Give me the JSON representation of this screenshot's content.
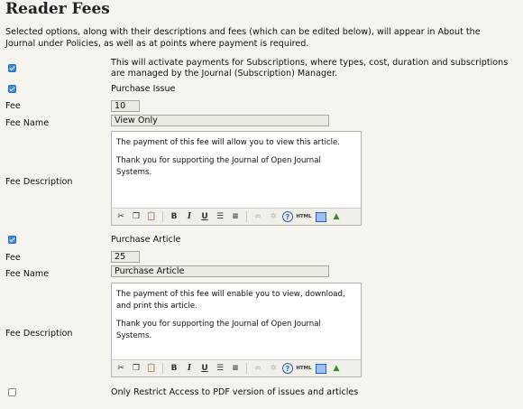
{
  "page": {
    "title": "Reader Fees",
    "intro": "Selected options, along with their descriptions and fees (which can be edited below), will appear in About the Journal under Policies, as well as at points where payment is required."
  },
  "subscriptions": {
    "checked": true,
    "text": "This will activate payments for Subscriptions, where types, cost, duration and subscriptions are managed by the Journal (Subscription) Manager."
  },
  "purchase_issue": {
    "checked": true,
    "label": "Purchase Issue",
    "fee_label": "Fee",
    "fee_value": "10",
    "fee_name_label": "Fee Name",
    "fee_name_value": "View Only",
    "desc_label": "Fee Description",
    "desc_paragraphs": [
      "The payment of this fee will allow you to view this article.",
      "Thank you for supporting the Journal of Open Journal Systems."
    ]
  },
  "purchase_article": {
    "checked": true,
    "label": "Purchase Article",
    "fee_label": "Fee",
    "fee_value": "25",
    "fee_name_label": "Fee Name",
    "fee_name_value": "Purchase Article",
    "desc_label": "Fee Description",
    "desc_paragraphs": [
      "The payment of this fee will enable you to view, download, and print this article.",
      "Thank you for supporting the Journal of Open Journal Systems."
    ]
  },
  "restrict_pdf": {
    "checked": false,
    "label": "Only Restrict Access to PDF version of issues and articles"
  },
  "toolbar": {
    "icons": [
      "cut-icon",
      "copy-icon",
      "paste-icon",
      "bold-icon",
      "italic-icon",
      "underline-icon",
      "bullet-list-icon",
      "numbered-list-icon",
      "link-icon",
      "unlink-icon",
      "help-icon",
      "html-icon",
      "fullscreen-icon",
      "image-icon"
    ],
    "bold": "B",
    "italic": "I",
    "underline": "U",
    "html": "HTML",
    "help": "?"
  },
  "colors": {
    "checkbox": "#3a8ae8",
    "background": "#f5f4ee",
    "input_bg": "#ecebe3"
  }
}
